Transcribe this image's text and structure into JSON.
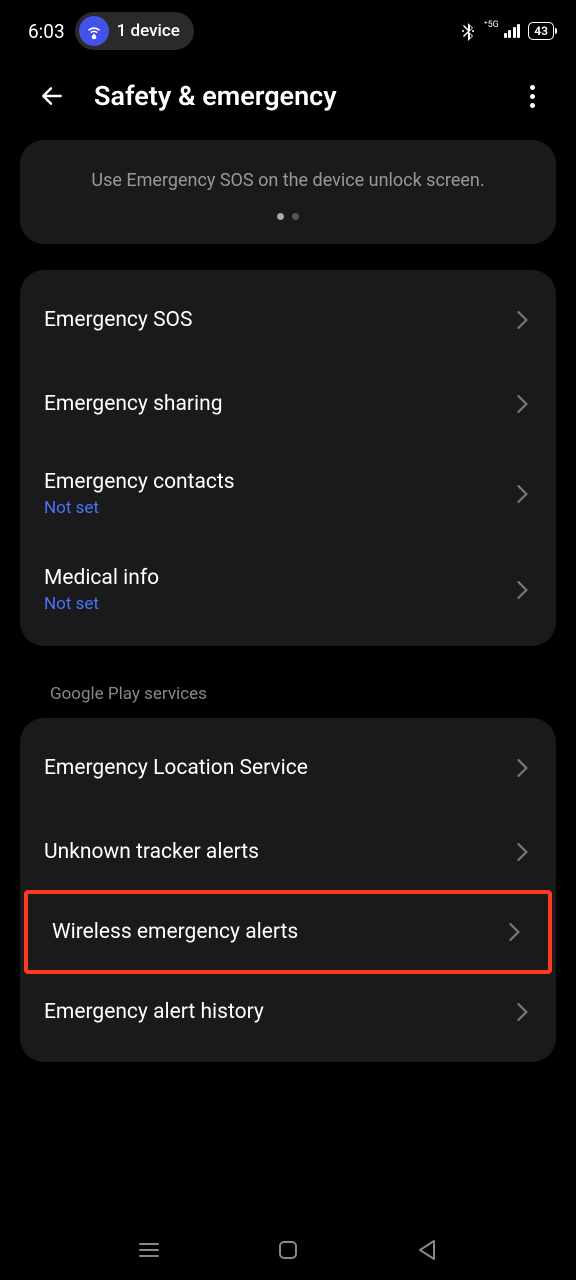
{
  "statusBar": {
    "time": "6:03",
    "deviceCount": "1 device",
    "networkLabel": "5G",
    "batteryLevel": "43"
  },
  "header": {
    "title": "Safety & emergency"
  },
  "infoCard": {
    "text": "Use Emergency SOS on the device unlock screen."
  },
  "group1": {
    "items": [
      {
        "title": "Emergency SOS",
        "subtitle": null
      },
      {
        "title": "Emergency sharing",
        "subtitle": null
      },
      {
        "title": "Emergency contacts",
        "subtitle": "Not set"
      },
      {
        "title": "Medical info",
        "subtitle": "Not set"
      }
    ]
  },
  "section2": {
    "header": "Google Play services"
  },
  "group2": {
    "items": [
      {
        "title": "Emergency Location Service"
      },
      {
        "title": "Unknown tracker alerts"
      },
      {
        "title": "Wireless emergency alerts"
      },
      {
        "title": "Emergency alert history"
      }
    ]
  }
}
